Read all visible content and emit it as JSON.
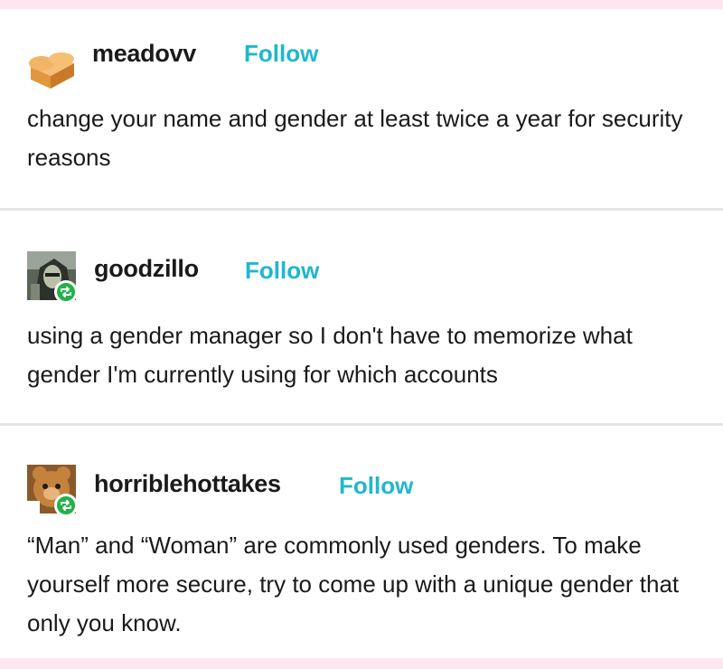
{
  "posts": [
    {
      "username": "meadovv",
      "follow_label": "Follow",
      "text": "change your name and gender at least twice a year for security reasons",
      "avatar_icon": "bread-loaf-icon"
    },
    {
      "username": "goodzillo",
      "follow_label": "Follow",
      "text": "using a gender manager so I don't have to memorize what gender I'm currently using for which accounts",
      "avatar_icon": "reblog-icon"
    },
    {
      "username": "horriblehottakes",
      "follow_label": "Follow",
      "text": "“Man” and “Woman” are commonly used genders. To make yourself more secure, try to come up with a unique gender that only you know.",
      "avatar_icon": "reblog-icon"
    }
  ],
  "colors": {
    "follow": "#1fb7cf",
    "reblog_badge": "#21b24a",
    "frame": "#fde6ef"
  }
}
